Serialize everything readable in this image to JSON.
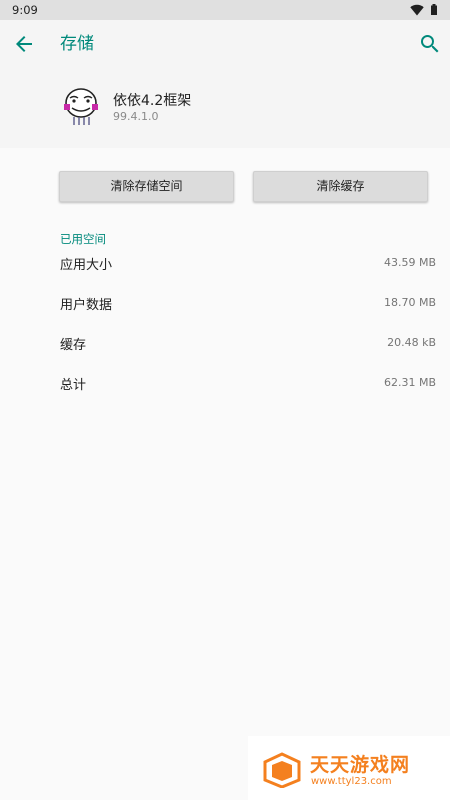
{
  "status_bar": {
    "time": "9:09"
  },
  "app_bar": {
    "title": "存储"
  },
  "app_info": {
    "name": "依依4.2框架",
    "version": "99.4.1.0"
  },
  "buttons": {
    "clear_storage": "清除存储空间",
    "clear_cache": "清除缓存"
  },
  "section": {
    "title": "已用空间"
  },
  "rows": [
    {
      "label": "应用大小",
      "value": "43.59 MB"
    },
    {
      "label": "用户数据",
      "value": "18.70 MB"
    },
    {
      "label": "缓存",
      "value": "20.48 kB"
    },
    {
      "label": "总计",
      "value": "62.31 MB"
    }
  ],
  "watermark": {
    "title": "天天游戏网",
    "url": "www.ttyl23.com"
  },
  "colors": {
    "accent": "#00897b",
    "watermark": "#f4801f"
  }
}
